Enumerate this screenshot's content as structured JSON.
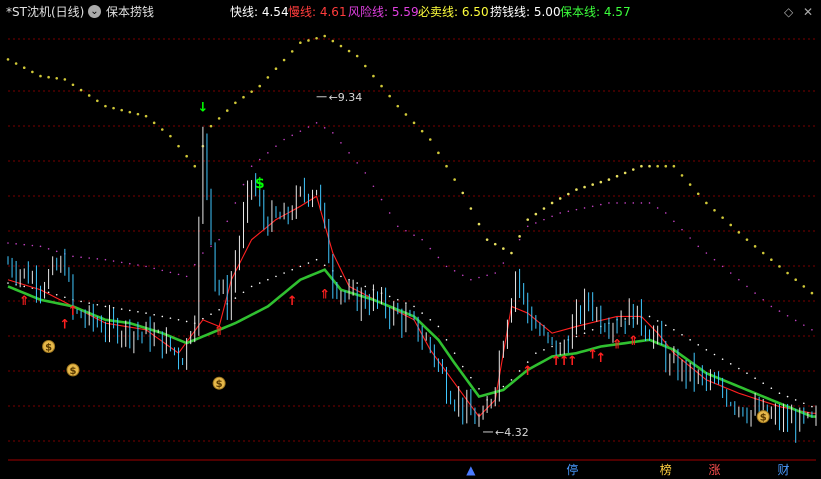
{
  "header": {
    "title": "*ST沈机(日线)",
    "indicator_name": "保本捞钱",
    "legend": [
      {
        "label": "快线: 4.54",
        "color": "#ffffff"
      },
      {
        "label": "慢线: 4.61",
        "color": "#ff3c3c"
      },
      {
        "label": "风险线: 5.59",
        "color": "#e040e0"
      },
      {
        "label": "必卖线: 6.50",
        "color": "#ffff3c"
      },
      {
        "label": "捞钱线: 5.00",
        "color": "#ffffff"
      },
      {
        "label": "保本线: 4.57",
        "color": "#3cff3c"
      }
    ]
  },
  "colors": {
    "background": "#000000",
    "grid": "#7a0000",
    "fast": "#ffffff",
    "slow": "#ff2020",
    "risk": "#c040c0",
    "sell": "#d8d040",
    "fish": "#ffffff",
    "breakeven": "#30c030",
    "signal_buy": "#ff2020",
    "signal_green": "#00ff00"
  },
  "chart_data": {
    "type": "line",
    "x_count": 200,
    "y_range": [
      3.9,
      10.4
    ],
    "grid": true,
    "annotations": [
      {
        "text": "9.34",
        "x": 76,
        "y": 9.34,
        "type": "high"
      },
      {
        "text": "4.32",
        "x": 117,
        "y": 4.32,
        "type": "low"
      }
    ],
    "series": [
      {
        "name": "快线",
        "value": 4.54,
        "style": "price",
        "key": [
          [
            0,
            6.85
          ],
          [
            8,
            6.55
          ],
          [
            14,
            6.85
          ],
          [
            16,
            6.1
          ],
          [
            24,
            5.9
          ],
          [
            30,
            5.85
          ],
          [
            36,
            5.75
          ],
          [
            43,
            5.45
          ],
          [
            46,
            6.1
          ],
          [
            48,
            8.7
          ],
          [
            51,
            6.6
          ],
          [
            54,
            6.25
          ],
          [
            57,
            7.2
          ],
          [
            60,
            8.1
          ],
          [
            63,
            7.5
          ],
          [
            68,
            7.5
          ],
          [
            72,
            7.85
          ],
          [
            76,
            8.0
          ],
          [
            80,
            6.6
          ],
          [
            84,
            6.3
          ],
          [
            90,
            6.3
          ],
          [
            100,
            5.9
          ],
          [
            104,
            5.6
          ],
          [
            108,
            5.0
          ],
          [
            114,
            4.55
          ],
          [
            117,
            4.45
          ],
          [
            120,
            5.1
          ],
          [
            123,
            6.1
          ],
          [
            125,
            6.7
          ],
          [
            128,
            6.1
          ],
          [
            132,
            5.7
          ],
          [
            136,
            5.5
          ],
          [
            140,
            6.0
          ],
          [
            143,
            6.3
          ],
          [
            146,
            6.0
          ],
          [
            150,
            6.0
          ],
          [
            154,
            6.1
          ],
          [
            160,
            5.7
          ],
          [
            163,
            5.3
          ],
          [
            168,
            5.2
          ],
          [
            175,
            4.95
          ],
          [
            182,
            4.65
          ],
          [
            190,
            4.5
          ],
          [
            198,
            4.45
          ]
        ]
      },
      {
        "name": "慢线",
        "value": 4.61,
        "style": "line",
        "key": [
          [
            0,
            6.6
          ],
          [
            8,
            6.45
          ],
          [
            16,
            6.2
          ],
          [
            24,
            5.95
          ],
          [
            34,
            5.85
          ],
          [
            42,
            5.5
          ],
          [
            48,
            6.0
          ],
          [
            52,
            5.9
          ],
          [
            55,
            6.6
          ],
          [
            60,
            7.2
          ],
          [
            66,
            7.5
          ],
          [
            72,
            7.7
          ],
          [
            76,
            7.85
          ],
          [
            80,
            7.0
          ],
          [
            84,
            6.5
          ],
          [
            92,
            6.25
          ],
          [
            100,
            6.0
          ],
          [
            104,
            5.55
          ],
          [
            110,
            5.05
          ],
          [
            116,
            4.55
          ],
          [
            120,
            4.8
          ],
          [
            124,
            6.2
          ],
          [
            128,
            6.1
          ],
          [
            134,
            5.8
          ],
          [
            140,
            5.9
          ],
          [
            150,
            6.05
          ],
          [
            156,
            6.05
          ],
          [
            160,
            5.8
          ],
          [
            164,
            5.5
          ],
          [
            172,
            5.1
          ],
          [
            180,
            4.9
          ],
          [
            190,
            4.7
          ],
          [
            198,
            4.6
          ]
        ]
      },
      {
        "name": "风险线",
        "value": 5.59,
        "style": "dotted",
        "key": [
          [
            0,
            7.15
          ],
          [
            8,
            7.1
          ],
          [
            16,
            6.95
          ],
          [
            24,
            6.9
          ],
          [
            34,
            6.8
          ],
          [
            44,
            6.65
          ],
          [
            48,
            7.0
          ],
          [
            52,
            7.2
          ],
          [
            60,
            8.3
          ],
          [
            68,
            8.7
          ],
          [
            76,
            8.95
          ],
          [
            80,
            8.8
          ],
          [
            88,
            8.2
          ],
          [
            96,
            7.4
          ],
          [
            102,
            7.2
          ],
          [
            108,
            6.8
          ],
          [
            114,
            6.6
          ],
          [
            120,
            6.7
          ],
          [
            124,
            7.0
          ],
          [
            128,
            7.4
          ],
          [
            136,
            7.6
          ],
          [
            148,
            7.75
          ],
          [
            158,
            7.75
          ],
          [
            162,
            7.6
          ],
          [
            170,
            7.1
          ],
          [
            180,
            6.6
          ],
          [
            188,
            6.2
          ],
          [
            198,
            5.85
          ]
        ]
      },
      {
        "name": "必卖线",
        "value": 6.5,
        "style": "dotted",
        "key": [
          [
            0,
            9.9
          ],
          [
            8,
            9.65
          ],
          [
            14,
            9.6
          ],
          [
            24,
            9.2
          ],
          [
            34,
            9.05
          ],
          [
            40,
            8.75
          ],
          [
            46,
            8.3
          ],
          [
            50,
            8.9
          ],
          [
            56,
            9.25
          ],
          [
            62,
            9.5
          ],
          [
            72,
            10.15
          ],
          [
            78,
            10.25
          ],
          [
            86,
            9.95
          ],
          [
            96,
            9.2
          ],
          [
            104,
            8.7
          ],
          [
            112,
            7.9
          ],
          [
            118,
            7.2
          ],
          [
            124,
            7.0
          ],
          [
            128,
            7.5
          ],
          [
            134,
            7.75
          ],
          [
            140,
            7.95
          ],
          [
            148,
            8.1
          ],
          [
            156,
            8.3
          ],
          [
            164,
            8.3
          ],
          [
            172,
            7.75
          ],
          [
            182,
            7.2
          ],
          [
            190,
            6.8
          ],
          [
            198,
            6.4
          ]
        ]
      },
      {
        "name": "捞钱线",
        "value": 5.0,
        "style": "dotted",
        "key": [
          [
            0,
            6.55
          ],
          [
            8,
            6.45
          ],
          [
            16,
            6.3
          ],
          [
            24,
            6.2
          ],
          [
            34,
            6.1
          ],
          [
            46,
            5.95
          ],
          [
            52,
            6.15
          ],
          [
            60,
            6.5
          ],
          [
            70,
            6.75
          ],
          [
            76,
            6.9
          ],
          [
            82,
            6.65
          ],
          [
            90,
            6.45
          ],
          [
            100,
            6.2
          ],
          [
            106,
            5.9
          ],
          [
            112,
            5.3
          ],
          [
            118,
            4.8
          ],
          [
            124,
            5.1
          ],
          [
            130,
            5.5
          ],
          [
            140,
            5.75
          ],
          [
            150,
            6.0
          ],
          [
            158,
            6.05
          ],
          [
            164,
            5.85
          ],
          [
            172,
            5.55
          ],
          [
            182,
            5.2
          ],
          [
            190,
            4.9
          ],
          [
            198,
            4.7
          ]
        ]
      },
      {
        "name": "保本线",
        "value": 4.57,
        "style": "thick",
        "key": [
          [
            0,
            6.5
          ],
          [
            8,
            6.3
          ],
          [
            16,
            6.2
          ],
          [
            24,
            6.0
          ],
          [
            30,
            5.95
          ],
          [
            38,
            5.8
          ],
          [
            44,
            5.65
          ],
          [
            50,
            5.8
          ],
          [
            56,
            5.95
          ],
          [
            64,
            6.2
          ],
          [
            72,
            6.6
          ],
          [
            78,
            6.75
          ],
          [
            82,
            6.45
          ],
          [
            90,
            6.3
          ],
          [
            100,
            6.05
          ],
          [
            106,
            5.7
          ],
          [
            110,
            5.35
          ],
          [
            116,
            4.85
          ],
          [
            122,
            4.95
          ],
          [
            128,
            5.25
          ],
          [
            134,
            5.45
          ],
          [
            140,
            5.5
          ],
          [
            146,
            5.6
          ],
          [
            152,
            5.65
          ],
          [
            158,
            5.7
          ],
          [
            164,
            5.55
          ],
          [
            172,
            5.2
          ],
          [
            182,
            4.95
          ],
          [
            190,
            4.75
          ],
          [
            198,
            4.55
          ]
        ]
      }
    ],
    "signals": [
      {
        "label": "⇑",
        "kind": "buy_double",
        "x": 4,
        "y": 6.4
      },
      {
        "label": "↑",
        "kind": "buy",
        "x": 14,
        "y": 6.05
      },
      {
        "label": "↑",
        "kind": "buy",
        "x": 16,
        "y": 6.25
      },
      {
        "label": "↓",
        "kind": "green_down",
        "x": 48,
        "y": 9.3
      },
      {
        "label": "$",
        "kind": "green_dollar",
        "x": 62,
        "y": 8.15
      },
      {
        "label": "⇑",
        "kind": "buy_double",
        "x": 52,
        "y": 5.95
      },
      {
        "label": "↑",
        "kind": "buy",
        "x": 70,
        "y": 6.4
      },
      {
        "label": "⇑",
        "kind": "buy_double",
        "x": 78,
        "y": 6.5
      },
      {
        "label": "↑",
        "kind": "buy",
        "x": 128,
        "y": 5.35
      },
      {
        "label": "↑",
        "kind": "buy",
        "x": 135,
        "y": 5.5
      },
      {
        "label": "↑",
        "kind": "buy",
        "x": 137,
        "y": 5.5
      },
      {
        "label": "↑",
        "kind": "buy",
        "x": 139,
        "y": 5.5
      },
      {
        "label": "↑",
        "kind": "buy",
        "x": 144,
        "y": 5.6
      },
      {
        "label": "↑",
        "kind": "buy",
        "x": 146,
        "y": 5.55
      },
      {
        "label": "⇑",
        "kind": "buy_double",
        "x": 150,
        "y": 5.75
      },
      {
        "label": "⇑",
        "kind": "buy_double",
        "x": 154,
        "y": 5.8
      }
    ],
    "money_bags": [
      {
        "label": "$",
        "x": 10,
        "y": 5.6
      },
      {
        "label": "$",
        "x": 16,
        "y": 5.25
      },
      {
        "label": "$",
        "x": 52,
        "y": 5.05
      },
      {
        "label": "$",
        "x": 186,
        "y": 4.55
      }
    ],
    "bottom_labels": [
      {
        "text": "▲",
        "x": 114,
        "color": "#4a7aff"
      },
      {
        "text": "停",
        "x": 139,
        "color": "#4a9aff"
      },
      {
        "text": "榜",
        "x": 162,
        "color": "#ffd040"
      },
      {
        "text": "涨",
        "x": 174,
        "color": "#ff5050"
      },
      {
        "text": "财",
        "x": 191,
        "color": "#4a9aff"
      }
    ]
  }
}
